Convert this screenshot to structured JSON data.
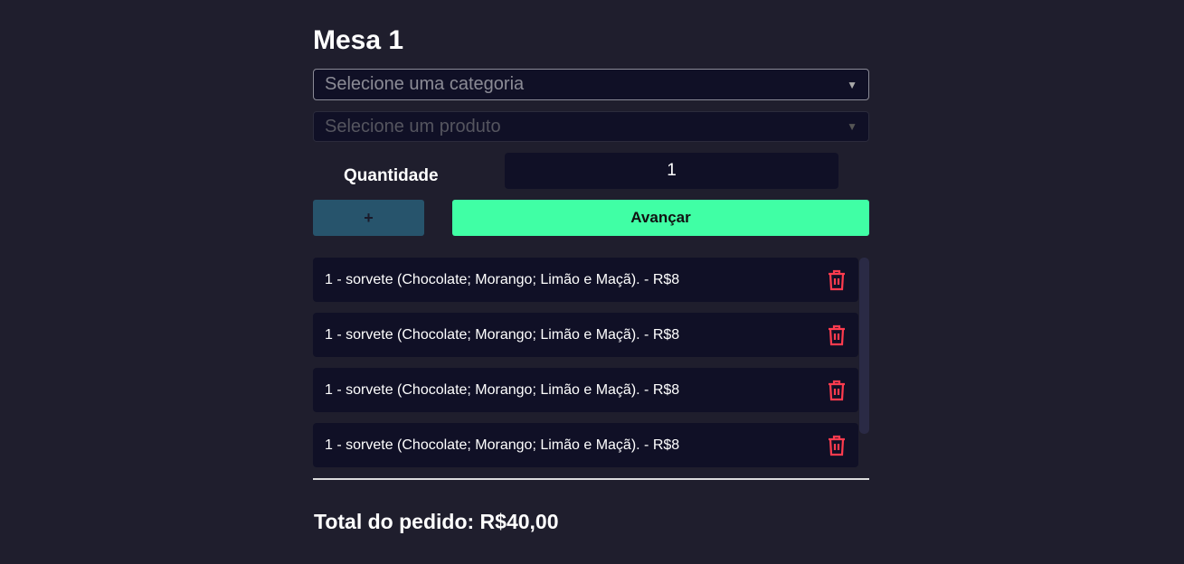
{
  "title": "Mesa 1",
  "category_select": {
    "placeholder": "Selecione uma categoria"
  },
  "product_select": {
    "placeholder": "Selecione um produto"
  },
  "quantity": {
    "label": "Quantidade",
    "value": "1"
  },
  "buttons": {
    "add": "+",
    "advance": "Avançar"
  },
  "items": [
    {
      "text": "1 - sorvete (Chocolate; Morango; Limão e Maçã). - R$8"
    },
    {
      "text": "1 - sorvete (Chocolate; Morango; Limão e Maçã). - R$8"
    },
    {
      "text": "1 - sorvete (Chocolate; Morango; Limão e Maçã). - R$8"
    },
    {
      "text": "1 - sorvete (Chocolate; Morango; Limão e Maçã). - R$8"
    }
  ],
  "total": "Total do pedido: R$40,00",
  "colors": {
    "accent": "#40ffa5",
    "danger": "#ff3b4e",
    "add_button": "#27546c"
  }
}
